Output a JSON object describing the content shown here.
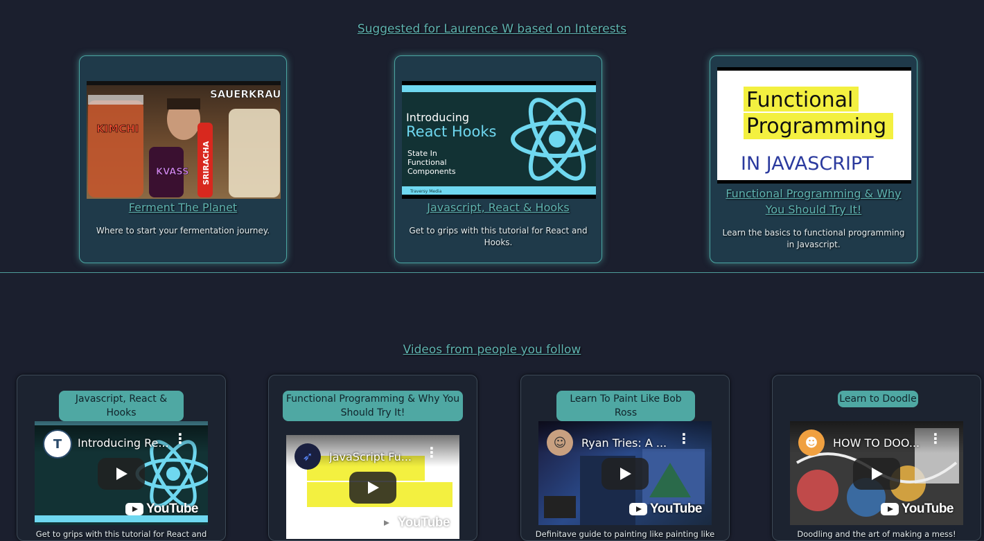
{
  "suggested": {
    "title": "Suggested for Laurence W based on Interests",
    "cards": [
      {
        "title": "Ferment The Planet",
        "desc": "Where to start your fermentation journey.",
        "thumb_labels": {
          "a": "KIMCHI",
          "b": "KVASS",
          "c": "SRIRACHA",
          "d": "SAUERKRAUT"
        }
      },
      {
        "title": "Javascript, React & Hooks",
        "desc": "Get to grips with this tutorial for React and Hooks.",
        "thumb_labels": {
          "line1": "Introducing",
          "line2": "React Hooks",
          "sub1": "State In",
          "sub2": "Functional",
          "sub3": "Components",
          "footer": "Traversy Media"
        }
      },
      {
        "title": "Functional Programming & Why You Should Try It!",
        "desc": "Learn the basics to functional programming in Javascript.",
        "thumb_labels": {
          "line1": "Functional",
          "line2": "Programming",
          "line3": "IN JAVASCRIPT"
        }
      }
    ]
  },
  "following": {
    "title": "Videos from people you follow",
    "cards": [
      {
        "title": "Javascript, React & Hooks",
        "video_title": "Introducing Re...",
        "desc": "Get to grips with this tutorial for React and",
        "avatar": "T",
        "logo": "YouTube"
      },
      {
        "title": "Functional Programming & Why You Should Try It!",
        "video_title": "JavaScript Fu...",
        "desc": "",
        "avatar": "",
        "logo": "YouTube"
      },
      {
        "title": "Learn To Paint Like Bob Ross",
        "video_title": "Ryan Tries: A ...",
        "desc": "Definitave guide to painting like painting like",
        "avatar": "",
        "logo": "YouTube"
      },
      {
        "title": "Learn to Doodle",
        "video_title": "HOW TO DOO...",
        "desc": "Doodling and the art of making a mess!",
        "avatar": "",
        "logo": "YouTube"
      }
    ]
  },
  "colors": {
    "background": "#1b1f2e",
    "accent": "#5fb3b0",
    "card": "#1f3a4a",
    "pill": "#4fa8a3"
  }
}
